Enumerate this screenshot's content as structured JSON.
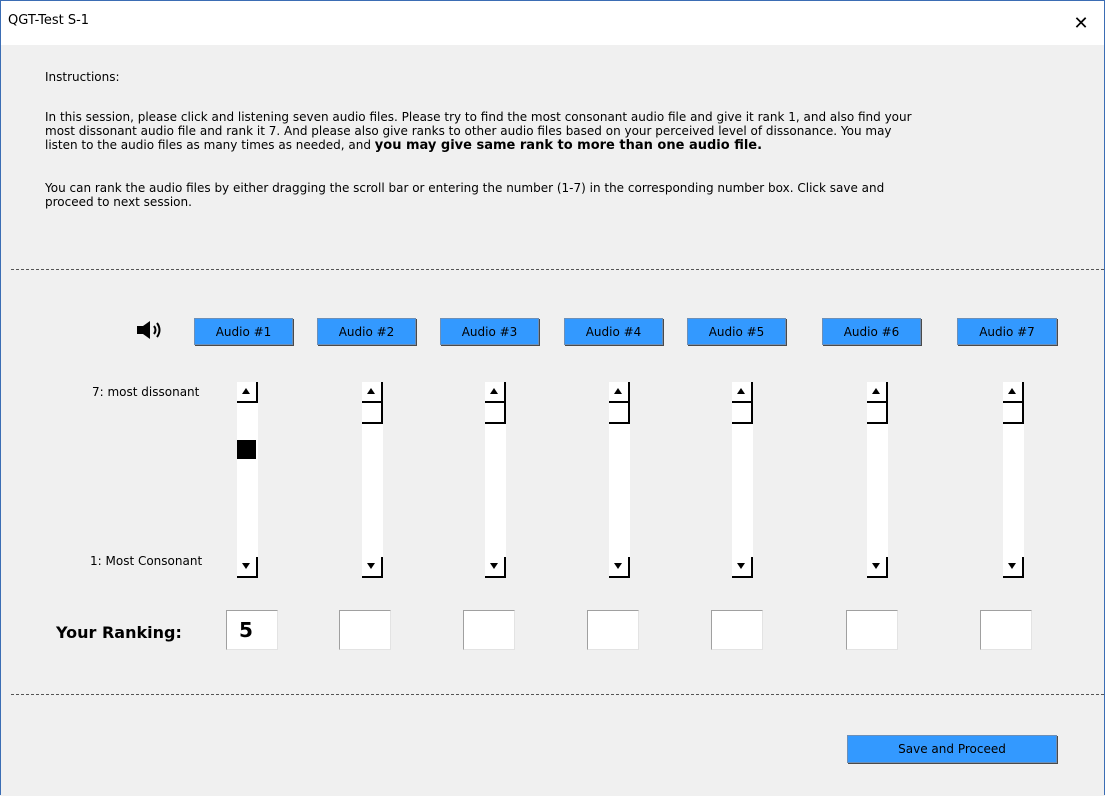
{
  "window": {
    "title": "QGT-Test S-1",
    "close_glyph": "✕"
  },
  "instructions": {
    "heading": "Instructions:",
    "para1_line1": "In this session, please click and listening seven audio files. Please try to find the most consonant audio file and give it rank 1, and also find your",
    "para1_line2": "most dissonant audio file and rank it 7. And please also give ranks to other audio files based on your perceived level of dissonance. You may",
    "para1_line3_plain": "listen to the audio files as many times as needed, and ",
    "para1_line3_bold": "you may give same rank to more than one audio file.",
    "para2_line1": "You can rank the audio files by either dragging the scroll bar or entering the number (1-7) in the corresponding number box. Click save and",
    "para2_line2": "proceed to next session."
  },
  "icons": {
    "speaker": "speaker-icon"
  },
  "audio_buttons": [
    {
      "label": "Audio #1"
    },
    {
      "label": "Audio #2"
    },
    {
      "label": "Audio #3"
    },
    {
      "label": "Audio #4"
    },
    {
      "label": "Audio #5"
    },
    {
      "label": "Audio #6"
    },
    {
      "label": "Audio #7"
    }
  ],
  "scale": {
    "top_label": "7: most dissonant",
    "bottom_label": "1: Most Consonant",
    "min": 1,
    "max": 7
  },
  "rankings": {
    "label": "Your Ranking:",
    "values": [
      "5",
      "",
      "",
      "",
      "",
      "",
      ""
    ]
  },
  "save_button": {
    "label": "Save and Proceed"
  },
  "colors": {
    "button_blue": "#3399ff",
    "background": "#f0f0f0"
  }
}
